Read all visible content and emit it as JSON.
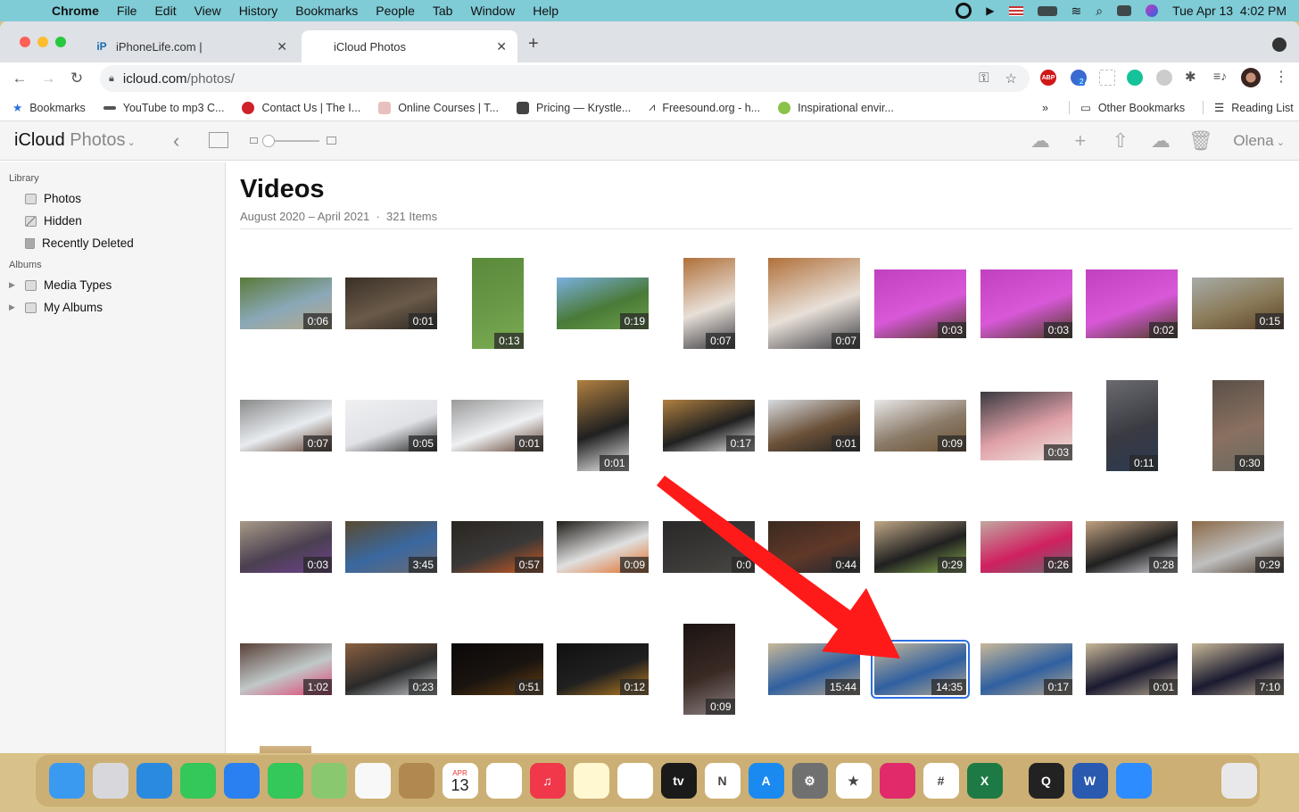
{
  "menubar": {
    "app": "Chrome",
    "items": [
      "File",
      "Edit",
      "View",
      "History",
      "Bookmarks",
      "People",
      "Tab",
      "Window",
      "Help"
    ],
    "datetime": "Tue Apr 13  4:02 PM",
    "status_icons": [
      "screen-record-icon",
      "play-icon",
      "us-flag-icon",
      "battery-icon",
      "wifi-icon",
      "spotlight-icon",
      "control-center-icon",
      "siri-icon"
    ]
  },
  "browser": {
    "tabs": [
      {
        "title": "iPhoneLife.com |",
        "favicon": "iP",
        "active": false
      },
      {
        "title": "iCloud Photos",
        "favicon": "",
        "active": true
      }
    ],
    "url_host": "icloud.com",
    "url_path": "/photos/",
    "extension_badge": "2",
    "bookmarks": [
      {
        "label": "Bookmarks",
        "color": "#2a6fe0"
      },
      {
        "label": "YouTube to mp3 C...",
        "color": "#555555"
      },
      {
        "label": "Contact Us | The I...",
        "color": "#d0202a"
      },
      {
        "label": "Online Courses | T...",
        "color": "#c88"
      },
      {
        "label": "Pricing — Krystle...",
        "color": "#444444"
      },
      {
        "label": "Freesound.org - h...",
        "color": "#333333"
      },
      {
        "label": "Inspirational envir...",
        "color": "#8bc34a"
      }
    ],
    "overflow": "»",
    "other_bookmarks": "Other Bookmarks",
    "reading_list": "Reading List"
  },
  "app": {
    "title_main": "iCloud",
    "title_sub": "Photos",
    "user": "Olena",
    "zoom_level": 0.15
  },
  "sidebar": {
    "library_header": "Library",
    "library_items": [
      "Photos",
      "Hidden",
      "Recently Deleted"
    ],
    "albums_header": "Albums",
    "album_items": [
      "Media Types",
      "My Albums"
    ]
  },
  "content": {
    "title": "Videos",
    "subtitle": "August 2020 – April 2021  ·  321 Items",
    "rows": [
      [
        {
          "dur": "0:06",
          "o": "l",
          "c": [
            "#5a7a3a",
            "#8aa8b8",
            "#b8a888"
          ]
        },
        {
          "dur": "0:01",
          "o": "l",
          "c": [
            "#3a3028",
            "#6a5a48",
            "#2a2622"
          ]
        },
        {
          "dur": "0:13",
          "o": "p",
          "c": [
            "#5a8a3a",
            "#6a9a48",
            "#7aaa50"
          ]
        },
        {
          "dur": "0:19",
          "o": "l",
          "c": [
            "#7ab0e0",
            "#4a7a38",
            "#6aa048"
          ]
        },
        {
          "dur": "0:07",
          "o": "p",
          "c": [
            "#b0703a",
            "#e8e0d8",
            "#3a3a40"
          ]
        },
        {
          "dur": "0:07",
          "o": "pw",
          "c": [
            "#b0703a",
            "#e8e0d8",
            "#3a3a40"
          ]
        },
        {
          "dur": "0:03",
          "o": "s",
          "c": [
            "#c040c0",
            "#d858d8",
            "#4a3a20"
          ]
        },
        {
          "dur": "0:03",
          "o": "s",
          "c": [
            "#c040c0",
            "#d858d8",
            "#4a3a20"
          ]
        },
        {
          "dur": "0:02",
          "o": "s",
          "c": [
            "#c040c0",
            "#d858d8",
            "#4a3a20"
          ]
        },
        {
          "dur": "0:15",
          "o": "l",
          "c": [
            "#a8aca8",
            "#8a7a58",
            "#5a4028"
          ]
        }
      ],
      [
        {
          "dur": "0:07",
          "o": "l",
          "c": [
            "#8a8a8a",
            "#e8ecf0",
            "#5a3a28"
          ]
        },
        {
          "dur": "0:05",
          "o": "l",
          "c": [
            "#f0f0f2",
            "#e0e2e6",
            "#202020"
          ]
        },
        {
          "dur": "0:01",
          "o": "l",
          "c": [
            "#9a9a9a",
            "#eef0f2",
            "#5a3a28"
          ]
        },
        {
          "dur": "0:01",
          "o": "p",
          "c": [
            "#b08040",
            "#202020",
            "#f0f0f0"
          ]
        },
        {
          "dur": "0:17",
          "o": "l",
          "c": [
            "#b08040",
            "#202020",
            "#f0f0f0"
          ]
        },
        {
          "dur": "0:01",
          "o": "l",
          "c": [
            "#d8dce0",
            "#6a5038",
            "#202020"
          ]
        },
        {
          "dur": "0:09",
          "o": "l",
          "c": [
            "#e8e8e8",
            "#8a7a68",
            "#6a5030"
          ]
        },
        {
          "dur": "0:03",
          "o": "s",
          "c": [
            "#3a3a40",
            "#e0a0a8",
            "#f0e8e0"
          ]
        },
        {
          "dur": "0:11",
          "o": "p",
          "c": [
            "#6a6a70",
            "#3a3a42",
            "#2a3a50"
          ]
        },
        {
          "dur": "0:30",
          "o": "p",
          "c": [
            "#5a5048",
            "#8a7060",
            "#6a6a60"
          ]
        }
      ],
      [
        {
          "dur": "0:03",
          "o": "l",
          "c": [
            "#a89a88",
            "#4a4050",
            "#704090"
          ]
        },
        {
          "dur": "3:45",
          "o": "l",
          "c": [
            "#5a4a30",
            "#3a68a0",
            "#6a6a70"
          ]
        },
        {
          "dur": "0:57",
          "o": "l",
          "c": [
            "#2a2620",
            "#3a3838",
            "#d05a20"
          ]
        },
        {
          "dur": "0:09",
          "o": "l",
          "c": [
            "#201c18",
            "#e0e0e0",
            "#e06a20"
          ]
        },
        {
          "dur": "0:0",
          "o": "l",
          "c": [
            "#2a2828",
            "#3a3836",
            "#4a4844"
          ]
        },
        {
          "dur": "0:44",
          "o": "l",
          "c": [
            "#3a2a20",
            "#603828",
            "#202830"
          ]
        },
        {
          "dur": "0:29",
          "o": "l",
          "c": [
            "#c0a888",
            "#202020",
            "#8ab050"
          ]
        },
        {
          "dur": "0:26",
          "o": "l",
          "c": [
            "#c0a8a0",
            "#d02060",
            "#6a6a70"
          ]
        },
        {
          "dur": "0:28",
          "o": "l",
          "c": [
            "#c0a080",
            "#202020",
            "#d8d8e0"
          ]
        },
        {
          "dur": "0:29",
          "o": "l",
          "c": [
            "#8a6a48",
            "#c0c0c0",
            "#4a3828"
          ]
        }
      ],
      [
        {
          "dur": "1:02",
          "o": "l",
          "c": [
            "#5a4038",
            "#c0c8c8",
            "#e04070"
          ]
        },
        {
          "dur": "0:23",
          "o": "l",
          "c": [
            "#8a6040",
            "#2a2a2a",
            "#c8ccd0"
          ]
        },
        {
          "dur": "0:51",
          "o": "l",
          "c": [
            "#0a0808",
            "#1a1410",
            "#6a4010"
          ]
        },
        {
          "dur": "0:12",
          "o": "l",
          "c": [
            "#101010",
            "#202020",
            "#c08020"
          ]
        },
        {
          "dur": "0:09",
          "o": "p",
          "c": [
            "#1a1412",
            "#3a2a24",
            "#8a8080"
          ]
        },
        {
          "dur": "15:44",
          "o": "l",
          "c": [
            "#c8b898",
            "#3060a0",
            "#b8a890"
          ]
        },
        {
          "dur": "14:35",
          "o": "l",
          "c": [
            "#c8b898",
            "#3060a0",
            "#b8a890"
          ],
          "selected": true
        },
        {
          "dur": "0:17",
          "o": "l",
          "c": [
            "#c8b898",
            "#3060a0",
            "#b8a890"
          ]
        },
        {
          "dur": "0:01",
          "o": "l",
          "c": [
            "#c8b898",
            "#1a1a30",
            "#b8a890"
          ]
        },
        {
          "dur": "7:10",
          "o": "l",
          "c": [
            "#c8b898",
            "#1a1a30",
            "#b8a890"
          ]
        }
      ]
    ]
  },
  "annotation": {
    "type": "arrow",
    "color": "#ff1a1a",
    "points_to": "video 14:35"
  },
  "dock": {
    "apps": [
      {
        "name": "finder",
        "label": "",
        "bg": "#3a9af0"
      },
      {
        "name": "launchpad",
        "label": "",
        "bg": "#d8d8dc"
      },
      {
        "name": "safari",
        "label": "",
        "bg": "#2a8ae0"
      },
      {
        "name": "messages",
        "label": "",
        "bg": "#34c759"
      },
      {
        "name": "mail",
        "label": "",
        "bg": "#2a80f0"
      },
      {
        "name": "facetime",
        "label": "",
        "bg": "#34c759"
      },
      {
        "name": "maps",
        "label": "",
        "bg": "#8ac870"
      },
      {
        "name": "photos",
        "label": "",
        "bg": "#f8f8f8"
      },
      {
        "name": "contacts",
        "label": "",
        "bg": "#b08850"
      },
      {
        "name": "calendar",
        "label": "13",
        "bg": "#ffffff",
        "sub": "APR"
      },
      {
        "name": "reminders",
        "label": "",
        "bg": "#ffffff"
      },
      {
        "name": "music",
        "label": "♫",
        "bg": "#f0384a"
      },
      {
        "name": "notes",
        "label": "",
        "bg": "#fff8d0"
      },
      {
        "name": "chrome",
        "label": "",
        "bg": "#ffffff"
      },
      {
        "name": "apple-tv",
        "label": "tv",
        "bg": "#1a1a1a"
      },
      {
        "name": "news",
        "label": "N",
        "bg": "#ffffff"
      },
      {
        "name": "app-store",
        "label": "A",
        "bg": "#1a8af0"
      },
      {
        "name": "system-preferences",
        "label": "⚙",
        "bg": "#707070"
      },
      {
        "name": "imovie",
        "label": "★",
        "bg": "#ffffff"
      },
      {
        "name": "scrivener",
        "label": "",
        "bg": "#e02a6a"
      },
      {
        "name": "slack",
        "label": "#",
        "bg": "#ffffff"
      },
      {
        "name": "excel",
        "label": "X",
        "bg": "#1e7a45"
      },
      {
        "name": "quicktime",
        "label": "Q",
        "bg": "#222222"
      },
      {
        "name": "word",
        "label": "W",
        "bg": "#2a5ab0"
      },
      {
        "name": "zoom",
        "label": "",
        "bg": "#2d8cff"
      },
      {
        "name": "rabbit-app",
        "label": "",
        "bg": "transparent"
      },
      {
        "name": "trash",
        "label": "",
        "bg": "#e8e8ea"
      }
    ]
  }
}
